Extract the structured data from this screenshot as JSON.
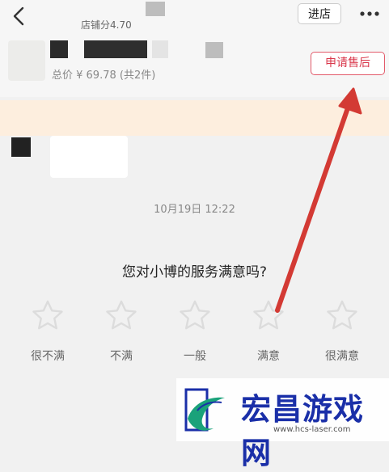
{
  "header": {
    "shop_score": "店铺分4.70",
    "enter_shop_label": "进店",
    "total_text": "总价 ¥ 69.78 (共2件)",
    "aftersale_label": "申请售后"
  },
  "chat": {
    "timestamp": "10月19日 12:22",
    "question": "您对小博的服务满意吗?",
    "ratings": [
      "很不满",
      "不满",
      "一般",
      "满意",
      "很满意"
    ]
  },
  "watermark": {
    "title": "宏昌游戏网",
    "url": "www.hcs-laser.com"
  },
  "colors": {
    "accent": "#d9364a",
    "arrow": "#d33a34",
    "notice_bg": "#fdeede",
    "watermark_blue": "#1a2fa8"
  }
}
